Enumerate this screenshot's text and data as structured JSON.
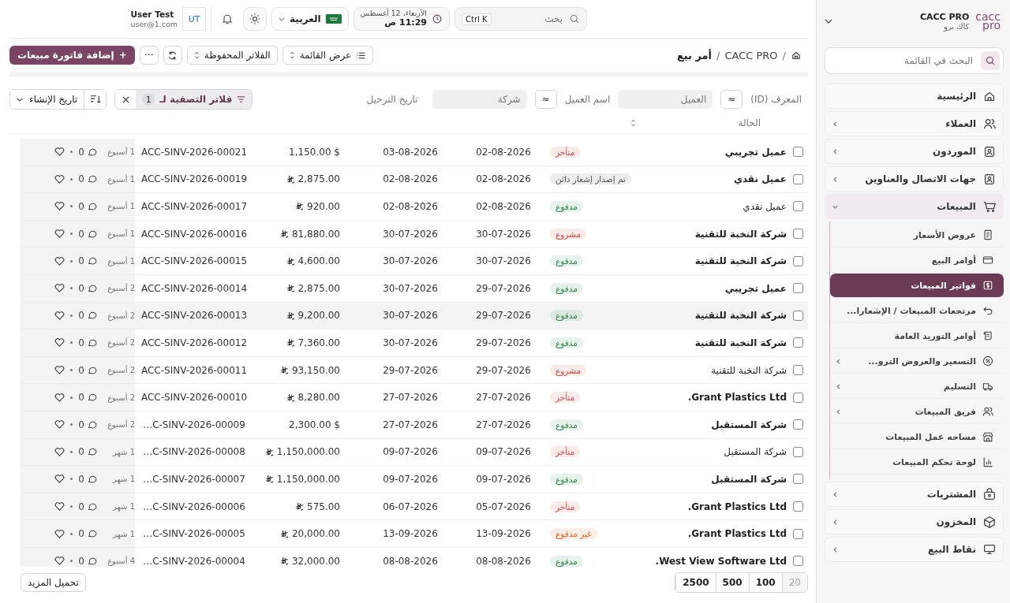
{
  "brand": {
    "name": "CACC PRO",
    "subtitle": "كاك برو",
    "logo_top": "cacc",
    "logo_bottom": "pro"
  },
  "sidebar": {
    "search": {
      "placeholder": "البحث في القائمة"
    },
    "items": [
      {
        "label": "الرئيسية",
        "has_arrow": false,
        "expanded": false,
        "selected": false
      },
      {
        "label": "العملاء",
        "has_arrow": true,
        "expanded": false,
        "selected": false
      },
      {
        "label": "الموردون",
        "has_arrow": true,
        "expanded": false,
        "selected": false
      },
      {
        "label": "جهات الاتصال والعناوين",
        "has_arrow": true,
        "expanded": false,
        "selected": false
      },
      {
        "label": "المبيعات",
        "has_arrow": true,
        "expanded": true,
        "selected": false,
        "children": [
          {
            "label": "عروض الأسعار",
            "has_arrow": false,
            "selected": false
          },
          {
            "label": "أوامر البيع",
            "has_arrow": false,
            "selected": false
          },
          {
            "label": "فواتير المبيعات",
            "has_arrow": false,
            "selected": true
          },
          {
            "label": "مرتجعات المبيعات / الإشعارا...",
            "has_arrow": false,
            "selected": false
          },
          {
            "label": "أوامر التوريد العامة",
            "has_arrow": false,
            "selected": false
          },
          {
            "label": "التسعير والعروض الترو...",
            "has_arrow": true,
            "selected": false
          },
          {
            "label": "التسليم",
            "has_arrow": true,
            "selected": false
          },
          {
            "label": "فريق المبيعات",
            "has_arrow": true,
            "selected": false
          },
          {
            "label": "مساحه عمل المبيعات",
            "has_arrow": false,
            "selected": false
          },
          {
            "label": "لوحة تحكم المبيعات",
            "has_arrow": false,
            "selected": false
          }
        ]
      },
      {
        "label": "المشتريات",
        "has_arrow": true,
        "expanded": false,
        "selected": false
      },
      {
        "label": "المخزون",
        "has_arrow": true,
        "expanded": false,
        "selected": false
      },
      {
        "label": "نقاط البيع",
        "has_arrow": true,
        "expanded": false,
        "selected": false
      }
    ]
  },
  "topbar": {
    "search": {
      "placeholder": "بحث",
      "shortcut": "Ctrl K"
    },
    "date": "الأربعاء، 12 أغسطس",
    "time": "11:29 ص",
    "language": "العربية",
    "user": {
      "initials": "UT",
      "name": "User Test",
      "email": "user@1.com"
    }
  },
  "breadcrumb": {
    "separator": "/",
    "items": [
      "CACC PRO",
      "أمر بيع"
    ]
  },
  "toolbar": {
    "list_view": "عرض القائمة",
    "saved_filters": "الفلاتر المحفوظة",
    "more": "···",
    "add_button": "إضافة فاتورة مبيعات",
    "add_icon": "+"
  },
  "filters": {
    "id_label": "المعرف (ID)",
    "operator_1": "≈",
    "customer_placeholder": "العميل",
    "name_label": "اسم العميل",
    "operator_2": "≈",
    "company_placeholder": "شركة",
    "date_label": "تاريخ الترحيل",
    "status_label": "الحالة",
    "filter_chip": "فلاتر التصفية لـ",
    "filter_count": "1",
    "sort_field": "تاريخ الإنشاء"
  },
  "rows": [
    {
      "name": "عميل تجريبي",
      "bold": true,
      "status": "متأخر",
      "color": "#d24848",
      "date_1": "02-08-2026",
      "date_2": "03-08-2026",
      "amount": "1,150.00 $",
      "riyal_sign": false,
      "id": "ACC-SINV-2026-00021",
      "age": "1 أسبوع",
      "comments": "0",
      "highlighted": false
    },
    {
      "name": "عميل نقدي",
      "bold": true,
      "status": "تم إصدار إشعار دائن",
      "color": "#555555",
      "date_1": "02-08-2026",
      "date_2": "02-08-2026",
      "amount": "2,875.00",
      "riyal_sign": true,
      "id": "ACC-SINV-2026-00019",
      "age": "1 أسبوع",
      "comments": "0",
      "highlighted": false
    },
    {
      "name": "عميل نقدي",
      "bold": false,
      "status": "مدفوع",
      "color": "#2d8a4e",
      "date_1": "02-08-2026",
      "date_2": "02-08-2026",
      "amount": "920.00",
      "riyal_sign": true,
      "id": "ACC-SINV-2026-00017",
      "age": "1 أسبوع",
      "comments": "0",
      "highlighted": false
    },
    {
      "name": "شركة النخبة للتقنية",
      "bold": true,
      "status": "مشروع",
      "color": "#d24848",
      "date_1": "30-07-2026",
      "date_2": "30-07-2026",
      "amount": "81,880.00",
      "riyal_sign": true,
      "id": "ACC-SINV-2026-00016",
      "age": "1 أسبوع",
      "comments": "0",
      "highlighted": false
    },
    {
      "name": "شركة النخبة للتقنية",
      "bold": true,
      "status": "مدفوع",
      "color": "#2d8a4e",
      "date_1": "30-07-2026",
      "date_2": "30-07-2026",
      "amount": "4,600.00",
      "riyal_sign": true,
      "id": "ACC-SINV-2026-00015",
      "age": "1 أسبوع",
      "comments": "0",
      "highlighted": false
    },
    {
      "name": "عميل تجريبي",
      "bold": true,
      "status": "مدفوع",
      "color": "#2d8a4e",
      "date_1": "29-07-2026",
      "date_2": "30-07-2026",
      "amount": "2,875.00",
      "riyal_sign": true,
      "id": "ACC-SINV-2026-00014",
      "age": "2 أسبوع",
      "comments": "0",
      "highlighted": false
    },
    {
      "name": "شركة النخبة للتقنية",
      "bold": true,
      "status": "مدفوع",
      "color": "#2d8a4e",
      "date_1": "29-07-2026",
      "date_2": "30-07-2026",
      "amount": "9,200.00",
      "riyal_sign": true,
      "id": "ACC-SINV-2026-00013",
      "age": "2 أسبوع",
      "comments": "0",
      "highlighted": true
    },
    {
      "name": "شركة النخبة للتقنية",
      "bold": true,
      "status": "مدفوع",
      "color": "#2d8a4e",
      "date_1": "29-07-2026",
      "date_2": "30-07-2026",
      "amount": "7,360.00",
      "riyal_sign": true,
      "id": "ACC-SINV-2026-00012",
      "age": "2 أسبوع",
      "comments": "0",
      "highlighted": false
    },
    {
      "name": "شركة النخبة للتقنية",
      "bold": false,
      "status": "مشروع",
      "color": "#d24848",
      "date_1": "29-07-2026",
      "date_2": "29-07-2026",
      "amount": "93,150.00",
      "riyal_sign": true,
      "id": "ACC-SINV-2026-00011",
      "age": "2 أسبوع",
      "comments": "0",
      "highlighted": false
    },
    {
      "name": "Grant Plastics Ltd.",
      "bold": true,
      "status": "متأخر",
      "color": "#d24848",
      "date_1": "27-07-2026",
      "date_2": "27-07-2026",
      "amount": "8,280.00",
      "riyal_sign": true,
      "id": "ACC-SINV-2026-00010",
      "age": "2 أسبوع",
      "comments": "0",
      "highlighted": false
    },
    {
      "name": "شركة المستقبل",
      "bold": true,
      "status": "مدفوع",
      "color": "#2d8a4e",
      "date_1": "27-07-2026",
      "date_2": "27-07-2026",
      "amount": "2,300.00 $",
      "riyal_sign": false,
      "id": "C-SINV-2026-00009…",
      "age": "2 أسبوع",
      "comments": "0",
      "highlighted": false
    },
    {
      "name": "شركة المستقبل",
      "bold": false,
      "status": "متأخر",
      "color": "#d24848",
      "date_1": "09-07-2026",
      "date_2": "09-07-2026",
      "amount": "1,150,000.00",
      "riyal_sign": true,
      "id": "C-SINV-2026-00008…",
      "age": "1 شهر",
      "comments": "0",
      "highlighted": false
    },
    {
      "name": "شركة المستقبل",
      "bold": true,
      "status": "مدفوع",
      "color": "#2d8a4e",
      "date_1": "09-07-2026",
      "date_2": "09-07-2026",
      "amount": "1,150,000.00",
      "riyal_sign": true,
      "id": "C-SINV-2026-00007…",
      "age": "1 شهر",
      "comments": "0",
      "highlighted": false
    },
    {
      "name": "Grant Plastics Ltd.",
      "bold": true,
      "status": "متأخر",
      "color": "#d24848",
      "date_1": "05-07-2026",
      "date_2": "06-07-2026",
      "amount": "575.00",
      "riyal_sign": true,
      "id": "C-SINV-2026-00006…",
      "age": "1 شهر",
      "comments": "0",
      "highlighted": false
    },
    {
      "name": "Grant Plastics Ltd.",
      "bold": true,
      "status": "غير مدفوع",
      "color": "#e06428",
      "date_1": "13-09-2026",
      "date_2": "13-09-2026",
      "amount": "20,000.00",
      "riyal_sign": true,
      "id": "C-SINV-2026-00005…",
      "age": "1 شهر",
      "comments": "0",
      "highlighted": false
    },
    {
      "name": "West View Software Ltd.",
      "bold": true,
      "status": "مدفوع",
      "color": "#2d8a4e",
      "date_1": "08-08-2026",
      "date_2": "08-08-2026",
      "amount": "32,000.00",
      "riyal_sign": true,
      "id": "C-SINV-2026-00004…",
      "age": "4 أسبوع",
      "comments": "0",
      "highlighted": false
    }
  ],
  "footer": {
    "page_sizes": [
      {
        "label": "20",
        "selected": true
      },
      {
        "label": "100",
        "selected": false
      },
      {
        "label": "500",
        "selected": false
      },
      {
        "label": "2500",
        "selected": false
      }
    ],
    "load_more": "تحميل المزيد"
  }
}
